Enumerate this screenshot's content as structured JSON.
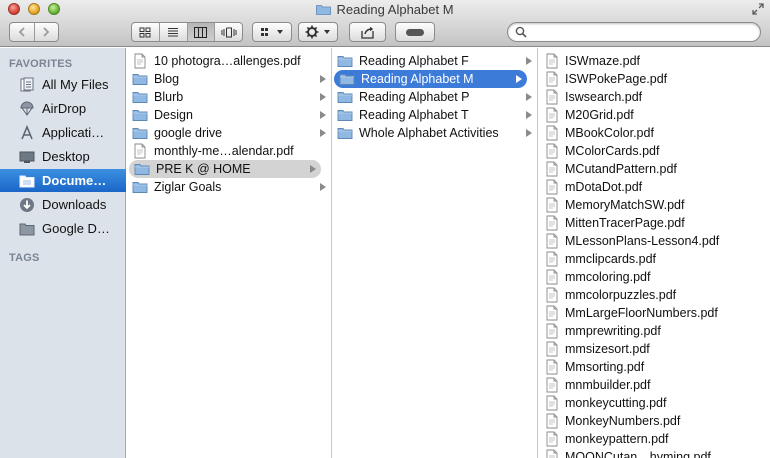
{
  "window": {
    "title": "Reading Alphabet M"
  },
  "toolbar": {
    "back_icon": "chevron-left-icon",
    "forward_icon": "chevron-right-icon",
    "views": [
      "icon-view-icon",
      "list-view-icon",
      "column-view-icon",
      "coverflow-view-icon"
    ],
    "active_view": "column-view-icon",
    "search": {
      "placeholder": "",
      "value": ""
    }
  },
  "sidebar": {
    "favorites_header": "FAVORITES",
    "tags_header": "TAGS",
    "items": [
      {
        "label": "All My Files",
        "icon": "all-files-icon"
      },
      {
        "label": "AirDrop",
        "icon": "airdrop-icon"
      },
      {
        "label": "Applicati…",
        "icon": "applications-icon"
      },
      {
        "label": "Desktop",
        "icon": "desktop-icon"
      },
      {
        "label": "Docume…",
        "icon": "documents-icon",
        "selected": true
      },
      {
        "label": "Downloads",
        "icon": "downloads-icon"
      },
      {
        "label": "Google D…",
        "icon": "folder-icon"
      }
    ]
  },
  "column1": {
    "items": [
      {
        "label": "10 photogra…allenges.pdf",
        "type": "pdf"
      },
      {
        "label": "Blog",
        "type": "folder"
      },
      {
        "label": "Blurb",
        "type": "folder"
      },
      {
        "label": "Design",
        "type": "folder"
      },
      {
        "label": "google drive",
        "type": "folder"
      },
      {
        "label": "monthly-me…alendar.pdf",
        "type": "pdf"
      },
      {
        "label": "PRE K @ HOME",
        "type": "folder",
        "selected": true
      },
      {
        "label": "Ziglar Goals",
        "type": "folder"
      }
    ]
  },
  "column2": {
    "items": [
      {
        "label": "Reading Alphabet F",
        "type": "folder"
      },
      {
        "label": "Reading Alphabet M",
        "type": "folder",
        "selected": true
      },
      {
        "label": "Reading Alphabet P",
        "type": "folder"
      },
      {
        "label": "Reading Alphabet T",
        "type": "folder"
      },
      {
        "label": "Whole Alphabet Activities",
        "type": "folder"
      }
    ]
  },
  "column3": {
    "items": [
      "ISWmaze.pdf",
      "ISWPokePage.pdf",
      "Iswsearch.pdf",
      "M20Grid.pdf",
      "MBookColor.pdf",
      "MColorCards.pdf",
      "MCutandPattern.pdf",
      "mDotaDot.pdf",
      "MemoryMatchSW.pdf",
      "MittenTracerPage.pdf",
      "MLessonPlans-Lesson4.pdf",
      "mmclipcards.pdf",
      "mmcoloring.pdf",
      "mmcolorpuzzles.pdf",
      "MmLargeFloorNumbers.pdf",
      "mmprewriting.pdf",
      "mmsizesort.pdf",
      "Mmsorting.pdf",
      "mnmbuilder.pdf",
      "monkeycutting.pdf",
      "MonkeyNumbers.pdf",
      "monkeypattern.pdf",
      "MOONCutan…hyming.pdf"
    ]
  },
  "colors": {
    "sidebar_bg": "#dce2ea",
    "sidebar_selected": "#1a66c9",
    "row_selected_blue": "#3d7bd9",
    "row_selected_gray": "#d3d3d3",
    "folder_blue": "#8fb8e2"
  }
}
